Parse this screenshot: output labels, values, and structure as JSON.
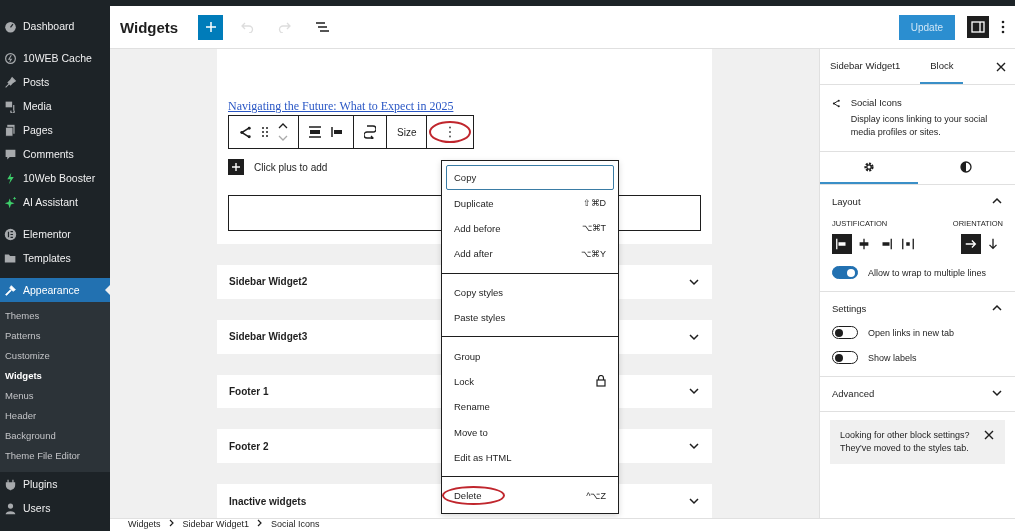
{
  "admin_menu": {
    "groups": [
      {
        "items": [
          {
            "label": "Dashboard",
            "kind": "gauge",
            "selected": false
          }
        ]
      },
      {
        "items": [
          {
            "label": "10WEB Cache",
            "kind": "cache",
            "selected": false
          },
          {
            "label": "Posts",
            "kind": "pin",
            "selected": false
          },
          {
            "label": "Media",
            "kind": "media",
            "selected": false
          },
          {
            "label": "Pages",
            "kind": "pages",
            "selected": false
          },
          {
            "label": "Comments",
            "kind": "comment",
            "selected": false
          },
          {
            "label": "10Web Booster",
            "kind": "bolt",
            "selected": false
          },
          {
            "label": "AI Assistant",
            "kind": "sparkle",
            "selected": false
          }
        ]
      },
      {
        "items": [
          {
            "label": "Elementor",
            "kind": "elementor",
            "selected": false
          },
          {
            "label": "Templates",
            "kind": "folder",
            "selected": false
          }
        ]
      },
      {
        "items": [
          {
            "label": "Appearance",
            "kind": "brush",
            "selected": true,
            "submenu": [
              {
                "label": "Themes",
                "selected": false
              },
              {
                "label": "Patterns",
                "selected": false
              },
              {
                "label": "Customize",
                "selected": false
              },
              {
                "label": "Widgets",
                "selected": true
              },
              {
                "label": "Menus",
                "selected": false
              },
              {
                "label": "Header",
                "selected": false
              },
              {
                "label": "Background",
                "selected": false
              },
              {
                "label": "Theme File Editor",
                "selected": false
              }
            ]
          },
          {
            "label": "Plugins",
            "kind": "plug",
            "selected": false
          },
          {
            "label": "Users",
            "kind": "user",
            "selected": false
          }
        ]
      }
    ]
  },
  "header": {
    "title": "Widgets",
    "tools": [
      {
        "kind": "add",
        "disabled": false
      },
      {
        "kind": "undo",
        "disabled": true
      },
      {
        "kind": "redo",
        "disabled": true
      },
      {
        "kind": "list",
        "disabled": false
      }
    ],
    "update": "Update",
    "sidebar_toggle": {
      "on": true
    }
  },
  "open_area": {
    "link": "Navigating the Future: What to Expect in 2025",
    "toolbar": {
      "size_label": "Size",
      "more_highlighted": true
    },
    "appender": "Click plus to add"
  },
  "collapsed_areas": [
    {
      "title": "Sidebar Widget2",
      "expanded": false
    },
    {
      "title": "Sidebar Widget3",
      "expanded": false
    },
    {
      "title": "Footer 1",
      "expanded": false
    },
    {
      "title": "Footer 2",
      "expanded": false
    },
    {
      "title": "Inactive widgets",
      "expanded": false
    }
  ],
  "block_menu": {
    "groups": [
      [
        {
          "label": "Copy",
          "selected": true,
          "kind": "plain",
          "highlighted": false
        },
        {
          "label": "Duplicate",
          "shortcut": "⇧⌘D",
          "selected": false,
          "kind": "plain",
          "highlighted": false
        },
        {
          "label": "Add before",
          "shortcut": "⌥⌘T",
          "selected": false,
          "kind": "plain",
          "highlighted": false
        },
        {
          "label": "Add after",
          "shortcut": "⌥⌘Y",
          "selected": false,
          "kind": "plain",
          "highlighted": false
        }
      ],
      [
        {
          "label": "Copy styles",
          "selected": false,
          "kind": "plain",
          "highlighted": false
        },
        {
          "label": "Paste styles",
          "selected": false,
          "kind": "plain",
          "highlighted": false
        }
      ],
      [
        {
          "label": "Group",
          "selected": false,
          "kind": "plain",
          "highlighted": false
        },
        {
          "label": "Lock",
          "selected": false,
          "kind": "lock",
          "highlighted": false
        },
        {
          "label": "Rename",
          "selected": false,
          "kind": "plain",
          "highlighted": false
        },
        {
          "label": "Move to",
          "selected": false,
          "kind": "plain",
          "highlighted": false
        },
        {
          "label": "Edit as HTML",
          "selected": false,
          "kind": "plain",
          "highlighted": false
        }
      ],
      [
        {
          "label": "Delete",
          "shortcut": "^⌥Z",
          "selected": false,
          "kind": "plain",
          "highlighted": true
        }
      ]
    ]
  },
  "inspector": {
    "tabs": [
      {
        "label": "Sidebar Widget1",
        "selected": false
      },
      {
        "label": "Block",
        "selected": true
      }
    ],
    "block": {
      "name": "Social Icons",
      "description": "Display icons linking to your social media profiles or sites."
    },
    "sub_tabs": [
      {
        "kind": "settings",
        "selected": true
      },
      {
        "kind": "styles",
        "selected": false
      }
    ],
    "layout": {
      "title": "Layout",
      "expanded": true,
      "justification_label": "JUSTIFICATION",
      "justification": [
        {
          "kind": "left",
          "selected": true
        },
        {
          "kind": "center",
          "selected": false
        },
        {
          "kind": "right",
          "selected": false
        },
        {
          "kind": "between",
          "selected": false
        }
      ],
      "orientation_label": "ORIENTATION",
      "orientation": [
        {
          "kind": "horizontal",
          "selected": true
        },
        {
          "kind": "vertical",
          "selected": false
        }
      ],
      "wrap": {
        "label": "Allow to wrap to multiple lines",
        "on": true
      }
    },
    "settings": {
      "title": "Settings",
      "expanded": true,
      "toggles": [
        {
          "label": "Open links in new tab",
          "on": false
        },
        {
          "label": "Show labels",
          "on": false
        }
      ]
    },
    "advanced": {
      "title": "Advanced",
      "expanded": false
    },
    "notice": "Looking for other block settings? They've moved to the styles tab."
  },
  "breadcrumb": [
    "Widgets",
    "Sidebar Widget1",
    "Social Icons"
  ]
}
